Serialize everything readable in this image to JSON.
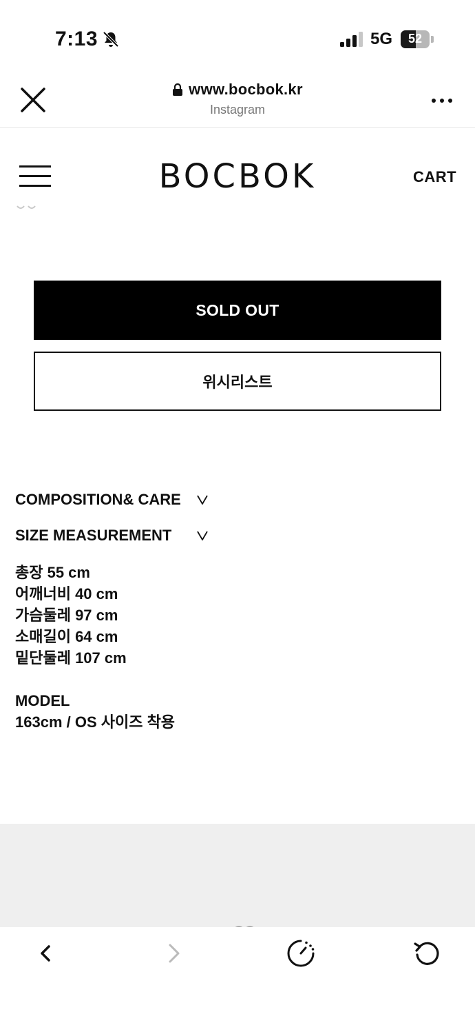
{
  "status_bar": {
    "time": "7:13",
    "network": "5G",
    "battery_level": "52",
    "battery_fraction": 0.52
  },
  "browser": {
    "url": "www.bocbok.kr",
    "source": "Instagram"
  },
  "header": {
    "logo": "BOCBOK",
    "cart": "CART"
  },
  "product": {
    "sold_out_label": "SOLD OUT",
    "wishlist_label": "위시리스트"
  },
  "accordions": [
    {
      "title": "COMPOSITION& CARE",
      "chevron": "v"
    },
    {
      "title": "SIZE MEASUREMENT",
      "chevron": "v"
    }
  ],
  "size_measurements": [
    "총장 55 cm",
    "어깨너비 40 cm",
    "가슴둘레 97 cm",
    "소매길이 64 cm",
    "밑단둘레 107 cm"
  ],
  "model": {
    "heading": "MODEL",
    "info": "163cm / OS 사이즈 착용"
  },
  "icons": {
    "close": "close-icon",
    "lock": "lock-icon",
    "more": "more-icon",
    "menu": "hamburger-icon",
    "back": "chevron-left-icon",
    "forward": "chevron-right-icon",
    "speed": "speedometer-icon",
    "reload": "reload-icon"
  },
  "colors": {
    "primary_text": "#111111",
    "sold_out_bg": "#000000",
    "gray_panel": "#efefef",
    "disabled": "#bbbbbb"
  }
}
